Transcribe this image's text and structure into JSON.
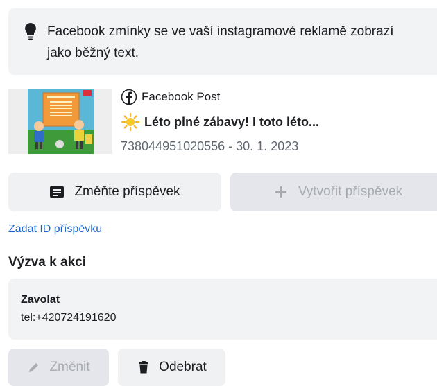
{
  "info": {
    "text": "Facebook zmínky se ve vaší instagramové reklamě zobrazí jako běžný text."
  },
  "post": {
    "source_label": "Facebook Post",
    "title": "Léto plné zábavy! I toto léto...",
    "id_date": "738044951020556 - 30. 1. 2023"
  },
  "buttons": {
    "change_post": "Změňte příspěvek",
    "create_post": "Vytvořit příspěvek",
    "edit": "Změnit",
    "remove": "Odebrat"
  },
  "link": {
    "enter_id": "Zadat ID příspěvku"
  },
  "cta": {
    "section_title": "Výzva k akci",
    "label": "Zavolat",
    "value": "tel:+420724191620"
  },
  "colors": {
    "link": "#1763cf",
    "panel_bg": "#f2f3f5",
    "disabled_text": "#a8abaf"
  }
}
